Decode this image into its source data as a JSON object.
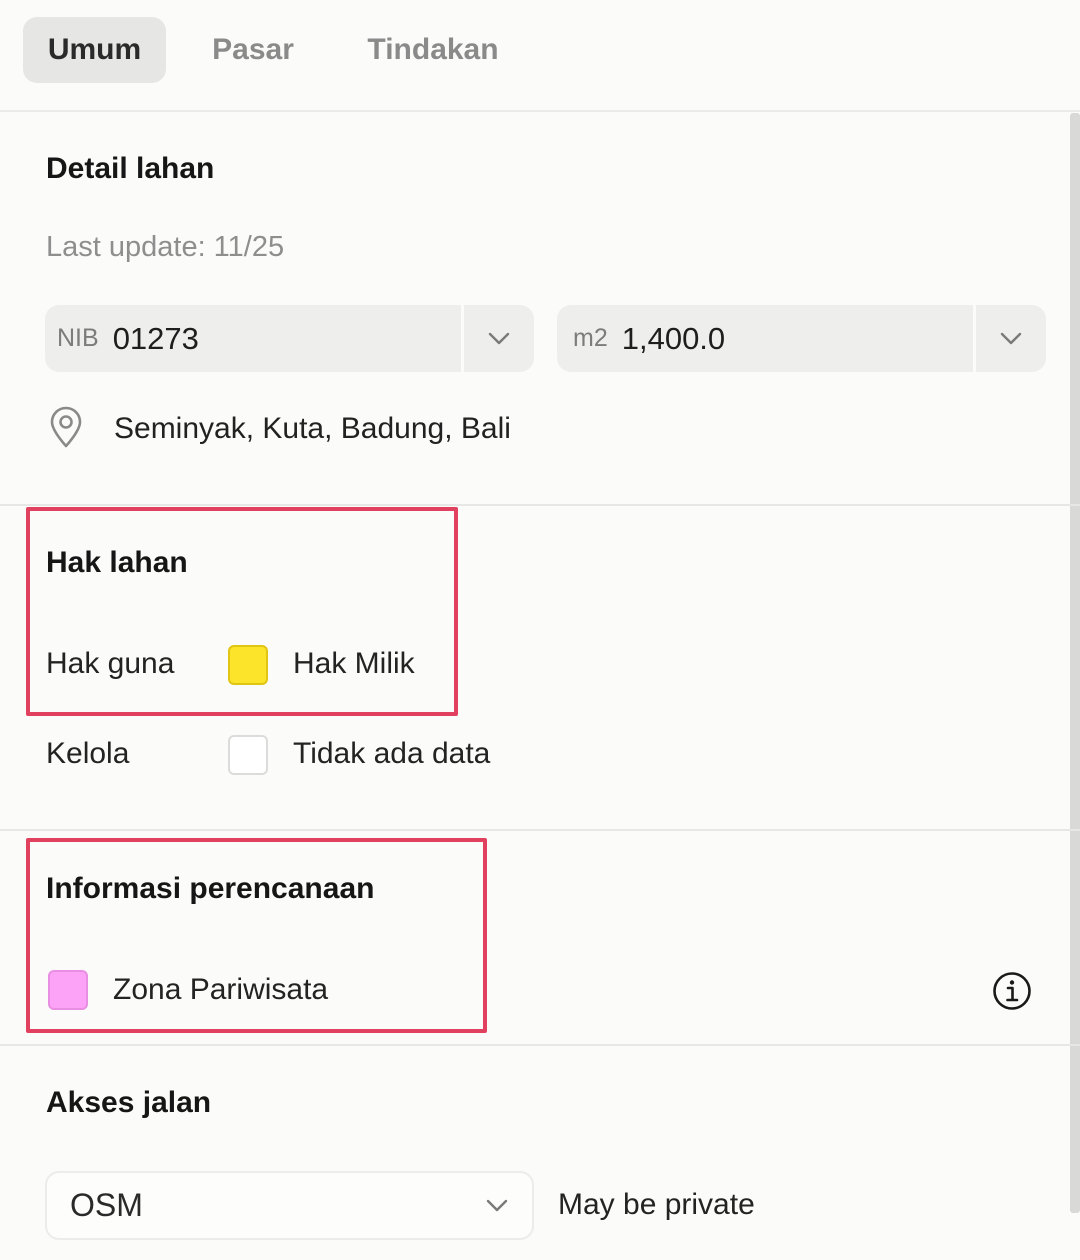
{
  "tabs": [
    {
      "label": "Umum",
      "active": true
    },
    {
      "label": "Pasar",
      "active": false
    },
    {
      "label": "Tindakan",
      "active": false
    }
  ],
  "detail": {
    "title": "Detail lahan",
    "last_update": "Last update: 11/25",
    "nib": {
      "prefix": "NIB",
      "value": "01273"
    },
    "area": {
      "prefix": "m2",
      "value": "1,400.0"
    },
    "location_icon": "map-pin-icon",
    "location": "Seminyak, Kuta, Badung, Bali"
  },
  "hak": {
    "title": "Hak lahan",
    "rows": [
      {
        "label": "Hak guna",
        "value": "Hak Milik",
        "color": "#fbe42a"
      },
      {
        "label": "Kelola",
        "value": "Tidak ada data",
        "color": "#ffffff"
      }
    ]
  },
  "perencanaan": {
    "title": "Informasi perencanaan",
    "zone": "Zona Pariwisata",
    "zone_color": "#fca3f7",
    "info_icon": "info-icon"
  },
  "akses": {
    "title": "Akses jalan",
    "source": "OSM",
    "note": "May be private"
  },
  "colors": {
    "highlight": "#e2405f",
    "tab_active_bg": "#e6e6e4"
  }
}
